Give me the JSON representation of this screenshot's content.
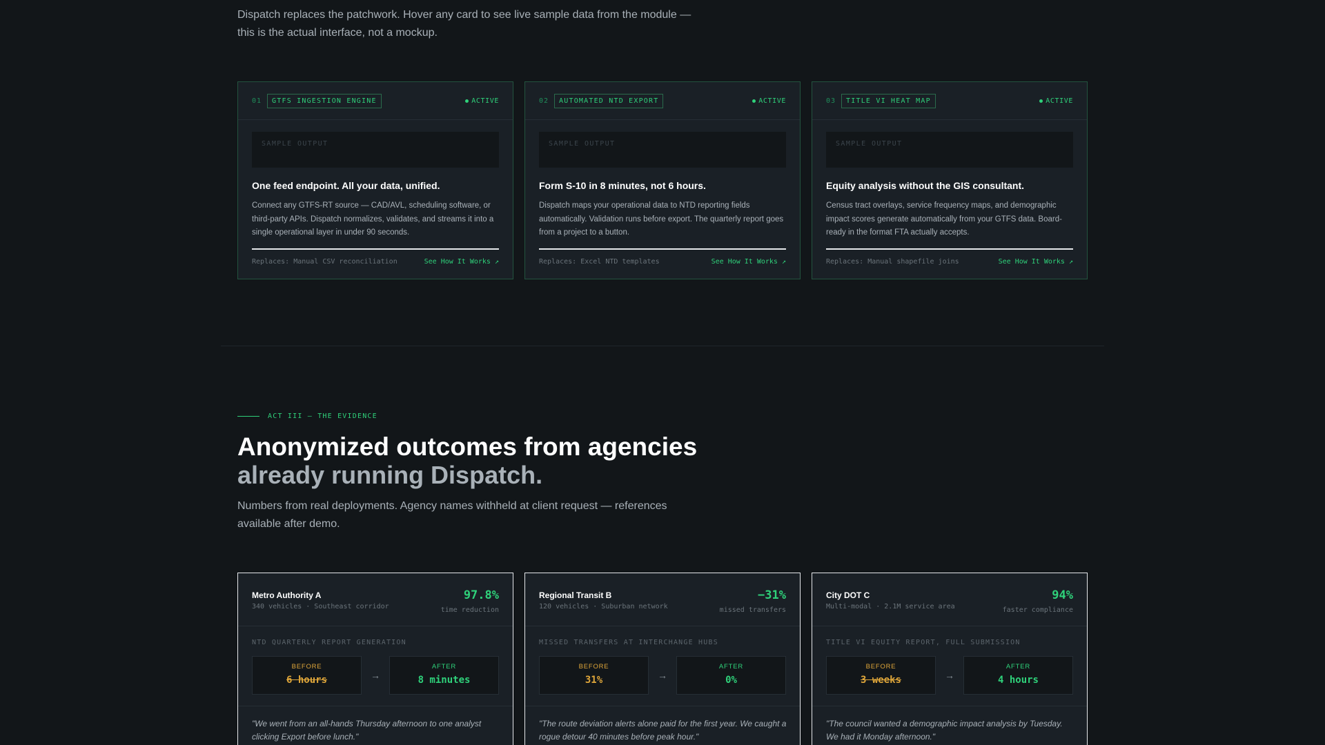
{
  "intro": "Dispatch replaces the patchwork. Hover any card to see live sample data from the module — this is the actual interface, not a mockup.",
  "modules": [
    {
      "num": "01",
      "tag": "GTFS INGESTION ENGINE",
      "status": "ACTIVE",
      "sample": "SAMPLE OUTPUT",
      "title": "One feed endpoint. All your data, unified.",
      "desc": "Connect any GTFS-RT source — CAD/AVL, scheduling software, or third-party APIs. Dispatch normalizes, validates, and streams it into a single operational layer in under 90 seconds.",
      "replaces": "Replaces: Manual CSV reconciliation",
      "link": "See How It Works ↗"
    },
    {
      "num": "02",
      "tag": "AUTOMATED NTD EXPORT",
      "status": "ACTIVE",
      "sample": "SAMPLE OUTPUT",
      "title": "Form S-10 in 8 minutes, not 6 hours.",
      "desc": "Dispatch maps your operational data to NTD reporting fields automatically. Validation runs before export. The quarterly report goes from a project to a button.",
      "replaces": "Replaces: Excel NTD templates",
      "link": "See How It Works ↗"
    },
    {
      "num": "03",
      "tag": "TITLE VI HEAT MAP",
      "status": "ACTIVE",
      "sample": "SAMPLE OUTPUT",
      "title": "Equity analysis without the GIS consultant.",
      "desc": "Census tract overlays, service frequency maps, and demographic impact scores generate automatically from your GTFS data. Board-ready in the format FTA actually accepts.",
      "replaces": "Replaces: Manual shapefile joins",
      "link": "See How It Works ↗"
    }
  ],
  "act3": {
    "eyebrow": "ACT III — THE EVIDENCE",
    "title": "Anonymized outcomes from agencies",
    "title_sub": "already running Dispatch.",
    "lede": "Numbers from real deployments. Agency names withheld at client request — references available after demo."
  },
  "outcomes": [
    {
      "name": "Metro Authority A",
      "meta": "340 vehicles · Southeast corridor",
      "stat": "97.8%",
      "stat_label": "time reduction",
      "label": "NTD QUARTERLY REPORT GENERATION",
      "before_label": "BEFORE",
      "before": "6 hours",
      "after_label": "AFTER",
      "after": "8 minutes",
      "quote": "\"We went from an all-hands Thursday afternoon to one analyst clicking Export before lunch.\""
    },
    {
      "name": "Regional Transit B",
      "meta": "120 vehicles · Suburban network",
      "stat": "−31%",
      "stat_label": "missed transfers",
      "label": "MISSED TRANSFERS AT INTERCHANGE HUBS",
      "before_label": "BEFORE",
      "before": "31%",
      "after_label": "AFTER",
      "after": "0%",
      "quote": "\"The route deviation alerts alone paid for the first year. We caught a rogue detour 40 minutes before peak hour.\""
    },
    {
      "name": "City DOT C",
      "meta": "Multi-modal · 2.1M service area",
      "stat": "94%",
      "stat_label": "faster compliance",
      "label": "TITLE VI EQUITY REPORT, FULL SUBMISSION",
      "before_label": "BEFORE",
      "before": "3 weeks",
      "after_label": "AFTER",
      "after": "4 hours",
      "quote": "\"The council wanted a demographic impact analysis by Tuesday. We had it Monday afternoon.\""
    }
  ],
  "colors": {
    "background": "#121619",
    "card": "#1a2026",
    "accent": "#2fd17a",
    "before": "#e0a73a"
  }
}
